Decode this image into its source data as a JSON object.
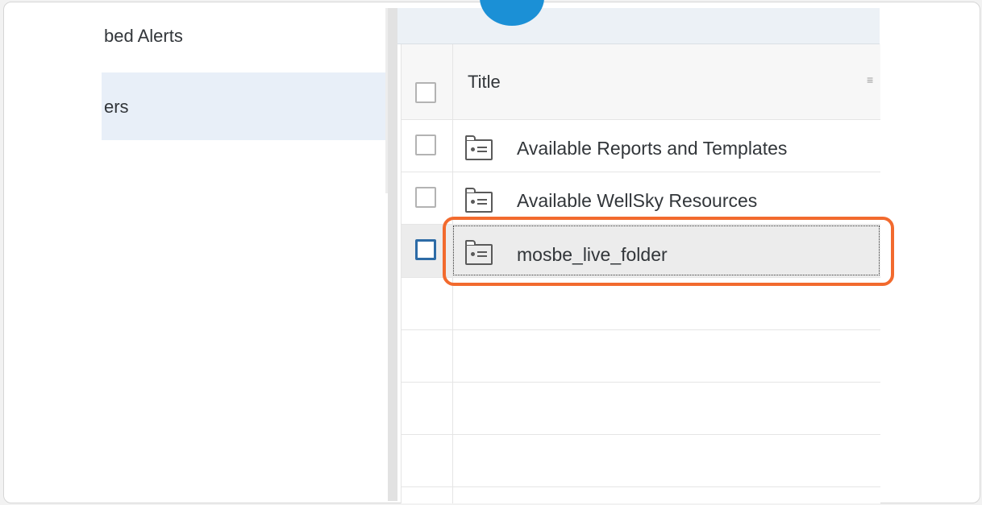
{
  "sidebar": {
    "items": [
      {
        "label": "bed Alerts",
        "active": false
      },
      {
        "label": "ers",
        "active": true
      }
    ]
  },
  "table": {
    "header": {
      "title_label": "Title",
      "sort_icon": "sort-icon"
    },
    "rows": [
      {
        "title": "Available Reports and Templates",
        "icon": "folder-icon",
        "selected": false
      },
      {
        "title": "Available WellSky Resources",
        "icon": "folder-icon",
        "selected": false
      },
      {
        "title": "mosbe_live_folder",
        "icon": "folder-icon",
        "selected": true,
        "highlighted": true
      }
    ]
  },
  "colors": {
    "accent": "#1b90d6",
    "highlight": "#f26a2e",
    "active_item_bg": "#e8eff8",
    "focused_checkbox": "#2d6ba6"
  }
}
